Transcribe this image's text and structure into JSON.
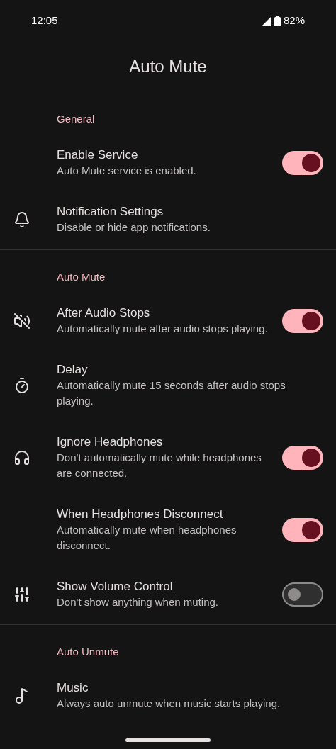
{
  "status_bar": {
    "time": "12:05",
    "battery": "82%"
  },
  "title": "Auto Mute",
  "sections": [
    {
      "header": "General",
      "items": [
        {
          "title": "Enable Service",
          "subtitle": "Auto Mute service is enabled.",
          "kind": "toggle",
          "on": true
        },
        {
          "title": "Notification Settings",
          "subtitle": "Disable or hide app notifications.",
          "kind": "plain"
        }
      ]
    },
    {
      "header": "Auto Mute",
      "items": [
        {
          "title": "After Audio Stops",
          "subtitle": "Automatically mute after audio stops playing.",
          "kind": "toggle",
          "on": true
        },
        {
          "title": "Delay",
          "subtitle": "Automatically mute 15 seconds after audio stops playing.",
          "kind": "plain"
        },
        {
          "title": "Ignore Headphones",
          "subtitle": "Don't automatically mute while headphones are connected.",
          "kind": "toggle",
          "on": true
        },
        {
          "title": "When Headphones Disconnect",
          "subtitle": "Automatically mute when headphones disconnect.",
          "kind": "toggle",
          "on": true
        },
        {
          "title": "Show Volume Control",
          "subtitle": "Don't show anything when muting.",
          "kind": "toggle",
          "on": false
        }
      ]
    },
    {
      "header": "Auto Unmute",
      "items": [
        {
          "title": "Music",
          "subtitle": "Always auto unmute when music starts playing.",
          "kind": "plain"
        }
      ]
    }
  ]
}
